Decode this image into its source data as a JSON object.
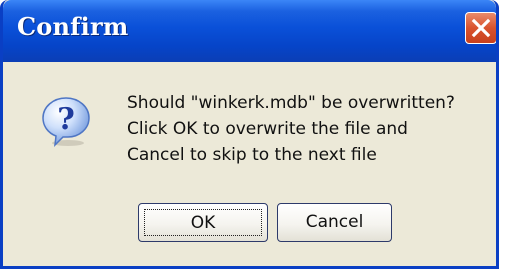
{
  "window": {
    "title": "Confirm"
  },
  "icons": {
    "dialog": "question-icon",
    "close": "close-icon"
  },
  "message": {
    "line1": "Should \"winkerk.mdb\" be overwritten?",
    "line2": "Click OK to overwrite the file and",
    "line3": "Cancel to skip to the next file"
  },
  "buttons": {
    "ok_label": "OK",
    "cancel_label": "Cancel"
  },
  "colors": {
    "titlebar": "#0a50d8",
    "close_button": "#d9532e",
    "dialog_background": "#ece9d8"
  }
}
